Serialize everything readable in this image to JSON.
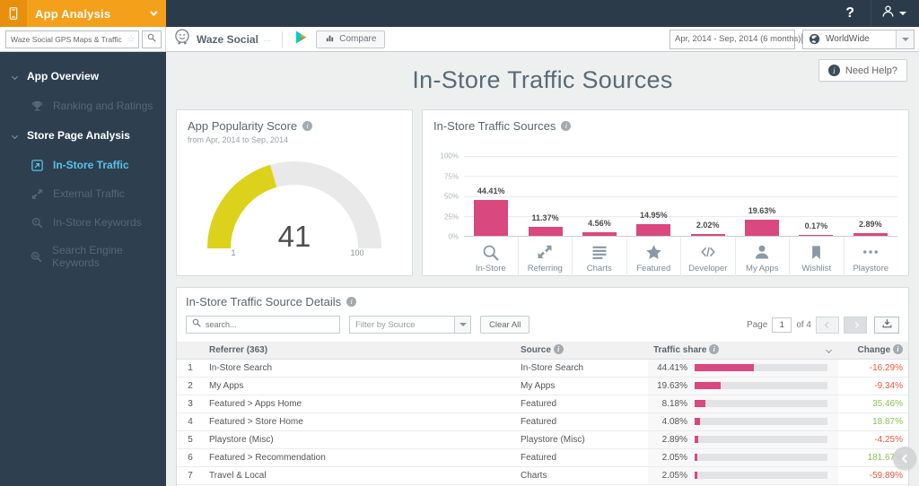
{
  "colors": {
    "accent_orange": "#f5a01a",
    "topbar_navy": "#2c3b4a",
    "sidebar_navy": "#2e3f50",
    "active_cyan": "#56c2e9",
    "bar_pink": "#d9487f",
    "gauge_yellow": "#ddd21b",
    "change_up_green": "#8cc152",
    "change_down_red": "#e9573f"
  },
  "topbar": {
    "product": "App Analysis",
    "help": "?"
  },
  "app_search": {
    "value": "Waze Social GPS Maps & Traffic"
  },
  "appbar": {
    "app_name": "Waze Social",
    "app_name_suffix": "...",
    "compare": "Compare",
    "date_range": "Apr, 2014 - Sep, 2014 (6 months)",
    "region": "WorldWide"
  },
  "sidebar": {
    "sections": [
      {
        "label": "App Overview",
        "items": [
          {
            "label": "Ranking and Ratings",
            "icon": "trophy-icon",
            "state": "disabled"
          }
        ]
      },
      {
        "label": "Store Page Analysis",
        "items": [
          {
            "label": "In-Store Traffic",
            "icon": "in-store-traffic-icon",
            "state": "active"
          },
          {
            "label": "External Traffic",
            "icon": "external-traffic-icon",
            "state": "disabled"
          },
          {
            "label": "In-Store Keywords",
            "icon": "in-store-keywords-icon",
            "state": "disabled"
          },
          {
            "label": "Search Engine Keywords",
            "icon": "search-engine-keywords-icon",
            "state": "disabled"
          }
        ]
      }
    ]
  },
  "page": {
    "title": "In-Store Traffic Sources",
    "need_help": "Need Help?"
  },
  "popularity": {
    "title": "App Popularity Score",
    "subtitle": "from Apr, 2014 to Sep, 2014",
    "value": 41,
    "max": 100,
    "min_label": "1",
    "max_label": "100"
  },
  "chart_data": [
    {
      "type": "gauge",
      "title": "App Popularity Score",
      "value": 41,
      "range": [
        1,
        100
      ],
      "fill_color": "#ddd21b",
      "track_color": "#e9e9e9"
    },
    {
      "type": "bar",
      "title": "In-Store Traffic Sources",
      "categories": [
        "In-Store",
        "Referring",
        "Charts",
        "Featured",
        "Developer",
        "My Apps",
        "Wishlist",
        "Playstore"
      ],
      "values": [
        44.41,
        11.37,
        4.56,
        14.95,
        2.02,
        19.63,
        0.17,
        2.89
      ],
      "labels": [
        "44.41%",
        "11.37%",
        "4.56%",
        "14.95%",
        "2.02%",
        "19.63%",
        "0.17%",
        "2.89%"
      ],
      "icons": [
        "magnifier-icon",
        "referring-arrows-icon",
        "charts-list-icon",
        "featured-star-icon",
        "developer-code-icon",
        "my-apps-person-icon",
        "wishlist-bookmark-icon",
        "playstore-ellipsis-icon"
      ],
      "yticks": [
        "100%",
        "75%",
        "50%",
        "25%",
        "0%"
      ],
      "ylim": [
        0,
        100
      ],
      "grid": true,
      "bar_color": "#d9487f"
    }
  ],
  "details": {
    "title": "In-Store Traffic Source Details",
    "search_placeholder": "search...",
    "filter_placeholder": "Filter by Source",
    "clear_all": "Clear All",
    "pagination": {
      "page_label": "Page",
      "current": "1",
      "total_label": "of 4"
    },
    "columns": {
      "referrer": "Referrer (363)",
      "source": "Source",
      "share": "Traffic share",
      "change": "Change"
    },
    "rows": [
      {
        "n": "1",
        "referrer": "In-Store Search",
        "source": "In-Store Search",
        "share": 44.41,
        "share_label": "44.41%",
        "change": "-16.29%",
        "trend": "down"
      },
      {
        "n": "2",
        "referrer": "My Apps",
        "source": "My Apps",
        "share": 19.63,
        "share_label": "19.63%",
        "change": "-9.34%",
        "trend": "down"
      },
      {
        "n": "3",
        "referrer": "Featured > Apps Home",
        "source": "Featured",
        "share": 8.18,
        "share_label": "8.18%",
        "change": "35.46%",
        "trend": "up"
      },
      {
        "n": "4",
        "referrer": "Featured > Store Home",
        "source": "Featured",
        "share": 4.08,
        "share_label": "4.08%",
        "change": "18.87%",
        "trend": "up"
      },
      {
        "n": "5",
        "referrer": "Playstore (Misc)",
        "source": "Playstore (Misc)",
        "share": 2.89,
        "share_label": "2.89%",
        "change": "-4.25%",
        "trend": "down"
      },
      {
        "n": "6",
        "referrer": "Featured > Recommendation",
        "source": "Featured",
        "share": 2.05,
        "share_label": "2.05%",
        "change": "181.67%",
        "trend": "up"
      },
      {
        "n": "7",
        "referrer": "Travel & Local",
        "source": "Charts",
        "share": 2.05,
        "share_label": "2.05%",
        "change": "-59.89%",
        "trend": "down"
      }
    ]
  }
}
